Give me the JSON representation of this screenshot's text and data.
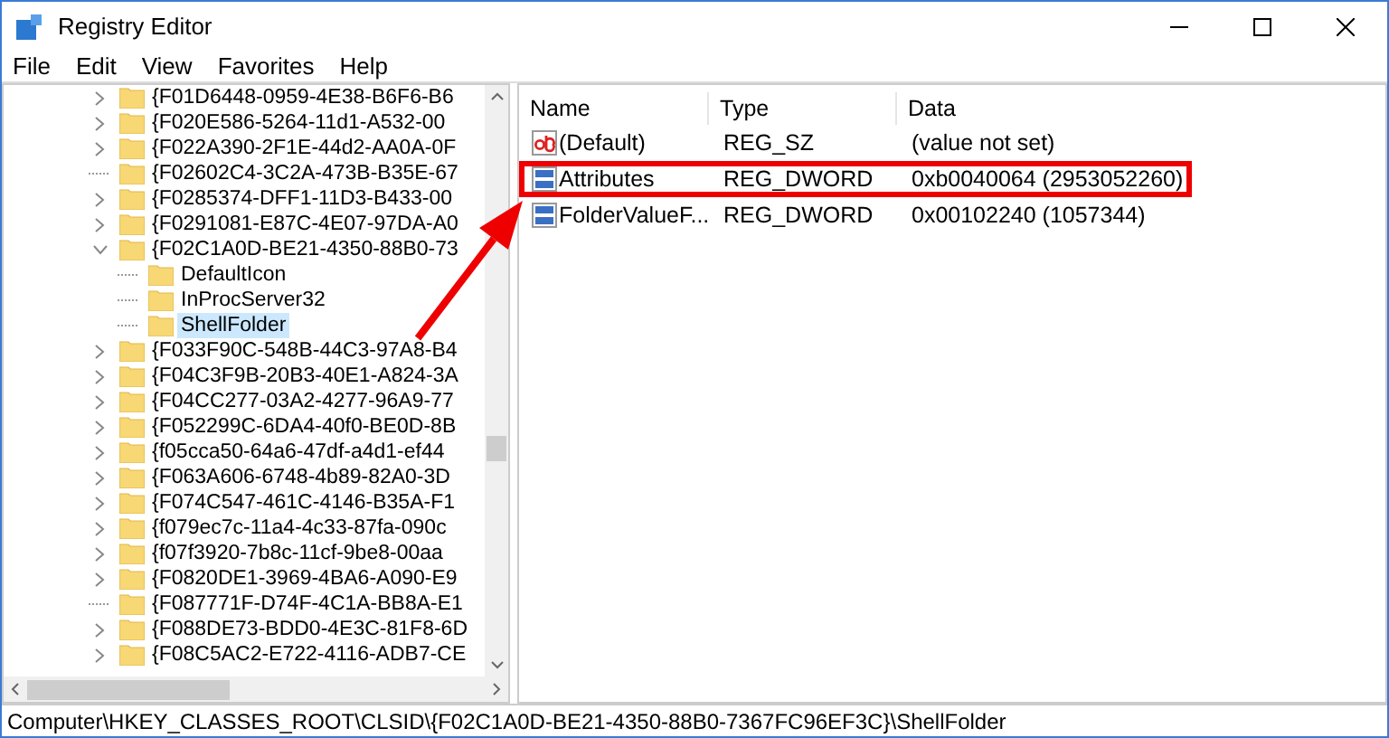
{
  "window": {
    "title": "Registry Editor"
  },
  "menu": [
    "File",
    "Edit",
    "View",
    "Favorites",
    "Help"
  ],
  "tree": [
    {
      "label": "{F01D6448-0959-4E38-B6F6-B6",
      "kind": "collapsed",
      "selected": false
    },
    {
      "label": "{F020E586-5264-11d1-A532-00",
      "kind": "collapsed",
      "selected": false
    },
    {
      "label": "{F022A390-2F1E-44d2-AA0A-0F",
      "kind": "collapsed",
      "selected": false
    },
    {
      "label": "{F02602C4-3C2A-473B-B35E-67",
      "kind": "leaf",
      "selected": false
    },
    {
      "label": "{F0285374-DFF1-11D3-B433-00",
      "kind": "collapsed",
      "selected": false
    },
    {
      "label": "{F0291081-E87C-4E07-97DA-A0",
      "kind": "collapsed",
      "selected": false
    },
    {
      "label": "{F02C1A0D-BE21-4350-88B0-73",
      "kind": "expanded",
      "selected": false,
      "children": [
        {
          "label": "DefaultIcon",
          "kind": "leaf",
          "selected": false
        },
        {
          "label": "InProcServer32",
          "kind": "leaf",
          "selected": false
        },
        {
          "label": "ShellFolder",
          "kind": "leaf",
          "selected": true
        }
      ]
    },
    {
      "label": "{F033F90C-548B-44C3-97A8-B4",
      "kind": "collapsed",
      "selected": false
    },
    {
      "label": "{F04C3F9B-20B3-40E1-A824-3A",
      "kind": "collapsed",
      "selected": false
    },
    {
      "label": "{F04CC277-03A2-4277-96A9-77",
      "kind": "collapsed",
      "selected": false
    },
    {
      "label": "{F052299C-6DA4-40f0-BE0D-8B",
      "kind": "collapsed",
      "selected": false
    },
    {
      "label": "{f05cca50-64a6-47df-a4d1-ef44",
      "kind": "collapsed",
      "selected": false
    },
    {
      "label": "{F063A606-6748-4b89-82A0-3D",
      "kind": "collapsed",
      "selected": false
    },
    {
      "label": "{F074C547-461C-4146-B35A-F1",
      "kind": "collapsed",
      "selected": false
    },
    {
      "label": "{f079ec7c-11a4-4c33-87fa-090c",
      "kind": "collapsed",
      "selected": false
    },
    {
      "label": "{f07f3920-7b8c-11cf-9be8-00aa",
      "kind": "collapsed",
      "selected": false
    },
    {
      "label": "{F0820DE1-3969-4BA6-A090-E9",
      "kind": "collapsed",
      "selected": false
    },
    {
      "label": "{F087771F-D74F-4C1A-BB8A-E1",
      "kind": "leaf",
      "selected": false
    },
    {
      "label": "{F088DE73-BDD0-4E3C-81F8-6D",
      "kind": "collapsed",
      "selected": false
    },
    {
      "label": "{F08C5AC2-E722-4116-ADB7-CE",
      "kind": "collapsed",
      "selected": false
    }
  ],
  "values": {
    "columns": [
      "Name",
      "Type",
      "Data"
    ],
    "rows": [
      {
        "name": "(Default)",
        "type": "REG_SZ",
        "data": "(value not set)",
        "kind": "string",
        "highlighted": false
      },
      {
        "name": "Attributes",
        "type": "REG_DWORD",
        "data": "0xb0040064 (2953052260)",
        "kind": "binary",
        "highlighted": true
      },
      {
        "name": "FolderValueF...",
        "type": "REG_DWORD",
        "data": "0x00102240 (1057344)",
        "kind": "binary",
        "highlighted": false
      }
    ]
  },
  "status_bar": "Computer\\HKEY_CLASSES_ROOT\\CLSID\\{F02C1A0D-BE21-4350-88B0-7367FC96EF3C}\\ShellFolder"
}
